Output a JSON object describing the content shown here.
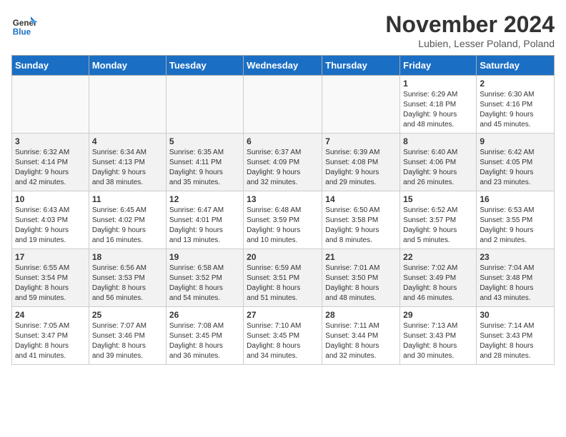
{
  "logo": {
    "text_general": "General",
    "text_blue": "Blue"
  },
  "title": "November 2024",
  "location": "Lubien, Lesser Poland, Poland",
  "days_of_week": [
    "Sunday",
    "Monday",
    "Tuesday",
    "Wednesday",
    "Thursday",
    "Friday",
    "Saturday"
  ],
  "weeks": [
    [
      {
        "day": "",
        "info": ""
      },
      {
        "day": "",
        "info": ""
      },
      {
        "day": "",
        "info": ""
      },
      {
        "day": "",
        "info": ""
      },
      {
        "day": "",
        "info": ""
      },
      {
        "day": "1",
        "info": "Sunrise: 6:29 AM\nSunset: 4:18 PM\nDaylight: 9 hours\nand 48 minutes."
      },
      {
        "day": "2",
        "info": "Sunrise: 6:30 AM\nSunset: 4:16 PM\nDaylight: 9 hours\nand 45 minutes."
      }
    ],
    [
      {
        "day": "3",
        "info": "Sunrise: 6:32 AM\nSunset: 4:14 PM\nDaylight: 9 hours\nand 42 minutes."
      },
      {
        "day": "4",
        "info": "Sunrise: 6:34 AM\nSunset: 4:13 PM\nDaylight: 9 hours\nand 38 minutes."
      },
      {
        "day": "5",
        "info": "Sunrise: 6:35 AM\nSunset: 4:11 PM\nDaylight: 9 hours\nand 35 minutes."
      },
      {
        "day": "6",
        "info": "Sunrise: 6:37 AM\nSunset: 4:09 PM\nDaylight: 9 hours\nand 32 minutes."
      },
      {
        "day": "7",
        "info": "Sunrise: 6:39 AM\nSunset: 4:08 PM\nDaylight: 9 hours\nand 29 minutes."
      },
      {
        "day": "8",
        "info": "Sunrise: 6:40 AM\nSunset: 4:06 PM\nDaylight: 9 hours\nand 26 minutes."
      },
      {
        "day": "9",
        "info": "Sunrise: 6:42 AM\nSunset: 4:05 PM\nDaylight: 9 hours\nand 23 minutes."
      }
    ],
    [
      {
        "day": "10",
        "info": "Sunrise: 6:43 AM\nSunset: 4:03 PM\nDaylight: 9 hours\nand 19 minutes."
      },
      {
        "day": "11",
        "info": "Sunrise: 6:45 AM\nSunset: 4:02 PM\nDaylight: 9 hours\nand 16 minutes."
      },
      {
        "day": "12",
        "info": "Sunrise: 6:47 AM\nSunset: 4:01 PM\nDaylight: 9 hours\nand 13 minutes."
      },
      {
        "day": "13",
        "info": "Sunrise: 6:48 AM\nSunset: 3:59 PM\nDaylight: 9 hours\nand 10 minutes."
      },
      {
        "day": "14",
        "info": "Sunrise: 6:50 AM\nSunset: 3:58 PM\nDaylight: 9 hours\nand 8 minutes."
      },
      {
        "day": "15",
        "info": "Sunrise: 6:52 AM\nSunset: 3:57 PM\nDaylight: 9 hours\nand 5 minutes."
      },
      {
        "day": "16",
        "info": "Sunrise: 6:53 AM\nSunset: 3:55 PM\nDaylight: 9 hours\nand 2 minutes."
      }
    ],
    [
      {
        "day": "17",
        "info": "Sunrise: 6:55 AM\nSunset: 3:54 PM\nDaylight: 8 hours\nand 59 minutes."
      },
      {
        "day": "18",
        "info": "Sunrise: 6:56 AM\nSunset: 3:53 PM\nDaylight: 8 hours\nand 56 minutes."
      },
      {
        "day": "19",
        "info": "Sunrise: 6:58 AM\nSunset: 3:52 PM\nDaylight: 8 hours\nand 54 minutes."
      },
      {
        "day": "20",
        "info": "Sunrise: 6:59 AM\nSunset: 3:51 PM\nDaylight: 8 hours\nand 51 minutes."
      },
      {
        "day": "21",
        "info": "Sunrise: 7:01 AM\nSunset: 3:50 PM\nDaylight: 8 hours\nand 48 minutes."
      },
      {
        "day": "22",
        "info": "Sunrise: 7:02 AM\nSunset: 3:49 PM\nDaylight: 8 hours\nand 46 minutes."
      },
      {
        "day": "23",
        "info": "Sunrise: 7:04 AM\nSunset: 3:48 PM\nDaylight: 8 hours\nand 43 minutes."
      }
    ],
    [
      {
        "day": "24",
        "info": "Sunrise: 7:05 AM\nSunset: 3:47 PM\nDaylight: 8 hours\nand 41 minutes."
      },
      {
        "day": "25",
        "info": "Sunrise: 7:07 AM\nSunset: 3:46 PM\nDaylight: 8 hours\nand 39 minutes."
      },
      {
        "day": "26",
        "info": "Sunrise: 7:08 AM\nSunset: 3:45 PM\nDaylight: 8 hours\nand 36 minutes."
      },
      {
        "day": "27",
        "info": "Sunrise: 7:10 AM\nSunset: 3:45 PM\nDaylight: 8 hours\nand 34 minutes."
      },
      {
        "day": "28",
        "info": "Sunrise: 7:11 AM\nSunset: 3:44 PM\nDaylight: 8 hours\nand 32 minutes."
      },
      {
        "day": "29",
        "info": "Sunrise: 7:13 AM\nSunset: 3:43 PM\nDaylight: 8 hours\nand 30 minutes."
      },
      {
        "day": "30",
        "info": "Sunrise: 7:14 AM\nSunset: 3:43 PM\nDaylight: 8 hours\nand 28 minutes."
      }
    ]
  ]
}
